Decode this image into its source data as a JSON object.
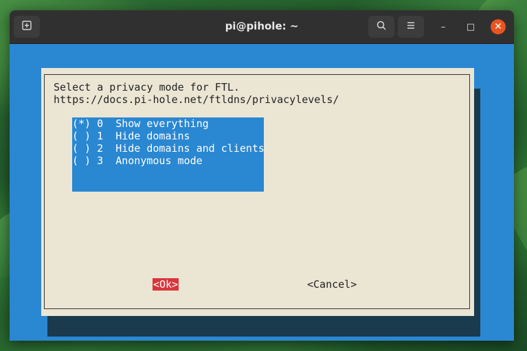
{
  "window": {
    "title": "pi@pihole: ~",
    "new_tab_icon": "new-tab-icon",
    "search_icon": "search-icon",
    "menu_icon": "hamburger-menu-icon",
    "minimize_glyph": "–",
    "maximize_glyph": "□",
    "close_glyph": "✕"
  },
  "dialog": {
    "prompt_line1": "Select a privacy mode for FTL.",
    "prompt_line2": "https://docs.pi-hole.net/ftldns/privacylevels/",
    "options": [
      {
        "marker": "(*)",
        "value": "0",
        "label": "Show everything",
        "selected": true
      },
      {
        "marker": "( )",
        "value": "1",
        "label": "Hide domains",
        "selected": false
      },
      {
        "marker": "( )",
        "value": "2",
        "label": "Hide domains and clients",
        "selected": false
      },
      {
        "marker": "( )",
        "value": "3",
        "label": "Anonymous mode",
        "selected": false
      }
    ],
    "ok_label": "<Ok>",
    "cancel_label": "<Cancel>"
  },
  "colors": {
    "terminal_bg": "#2a87d2",
    "dialog_bg": "#ebe6d4",
    "ok_highlight": "#d9363c",
    "close_button": "#e95420"
  }
}
